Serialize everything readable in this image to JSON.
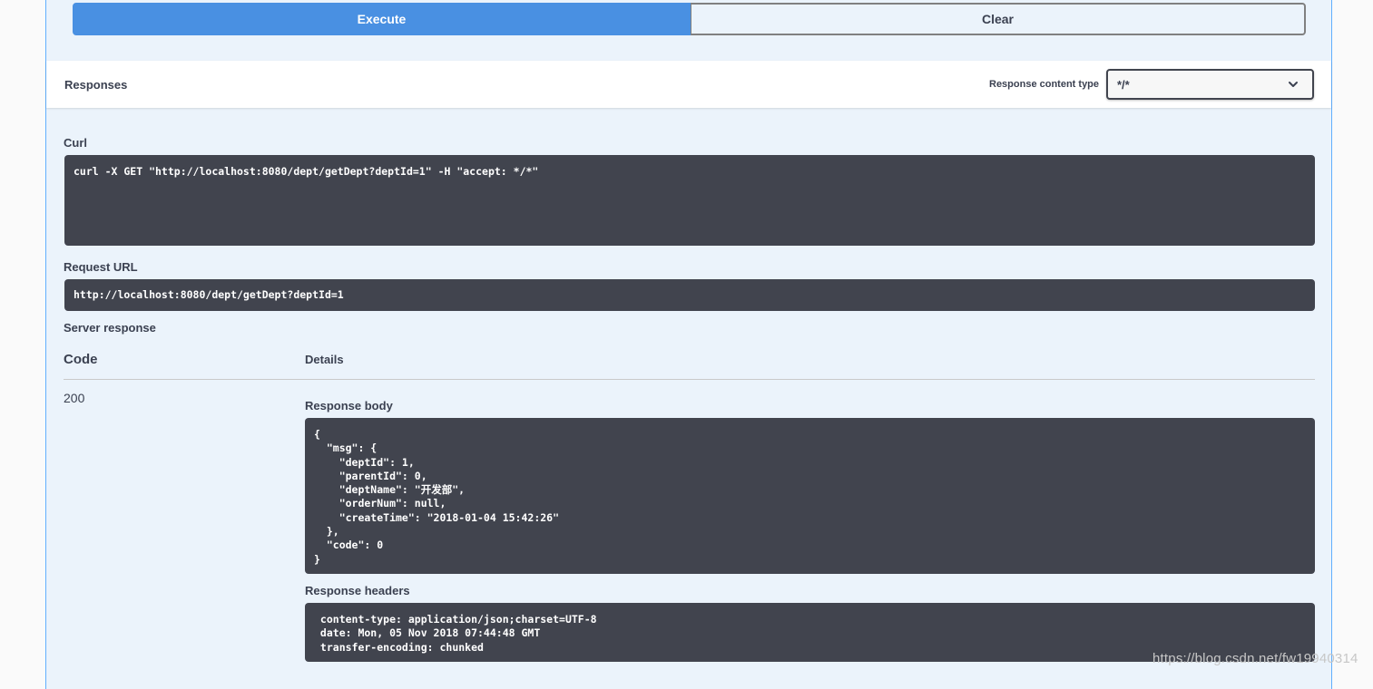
{
  "actions": {
    "execute_label": "Execute",
    "clear_label": "Clear"
  },
  "responses": {
    "title": "Responses",
    "content_type_label": "Response content type",
    "content_type_value": "*/*"
  },
  "curl": {
    "label": "Curl",
    "command": "curl -X GET \"http://localhost:8080/dept/getDept?deptId=1\" -H \"accept: */*\""
  },
  "request_url": {
    "label": "Request URL",
    "value": "http://localhost:8080/dept/getDept?deptId=1"
  },
  "server_response": {
    "label": "Server response",
    "col_code": "Code",
    "col_details": "Details",
    "code": "200",
    "body_label": "Response body",
    "body": "{\n  \"msg\": {\n    \"deptId\": 1,\n    \"parentId\": 0,\n    \"deptName\": \"开发部\",\n    \"orderNum\": null,\n    \"createTime\": \"2018-01-04 15:42:26\"\n  },\n  \"code\": 0\n}",
    "headers_label": "Response headers",
    "headers": " content-type: application/json;charset=UTF-8 \n date: Mon, 05 Nov 2018 07:44:48 GMT \n transfer-encoding: chunked "
  },
  "watermark": "https://blog.csdn.net/fw19940314",
  "colors": {
    "accent": "#4990e2",
    "panel_bg": "#ebf3fb",
    "code_bg": "#41444e",
    "border_blue": "#61affe"
  }
}
